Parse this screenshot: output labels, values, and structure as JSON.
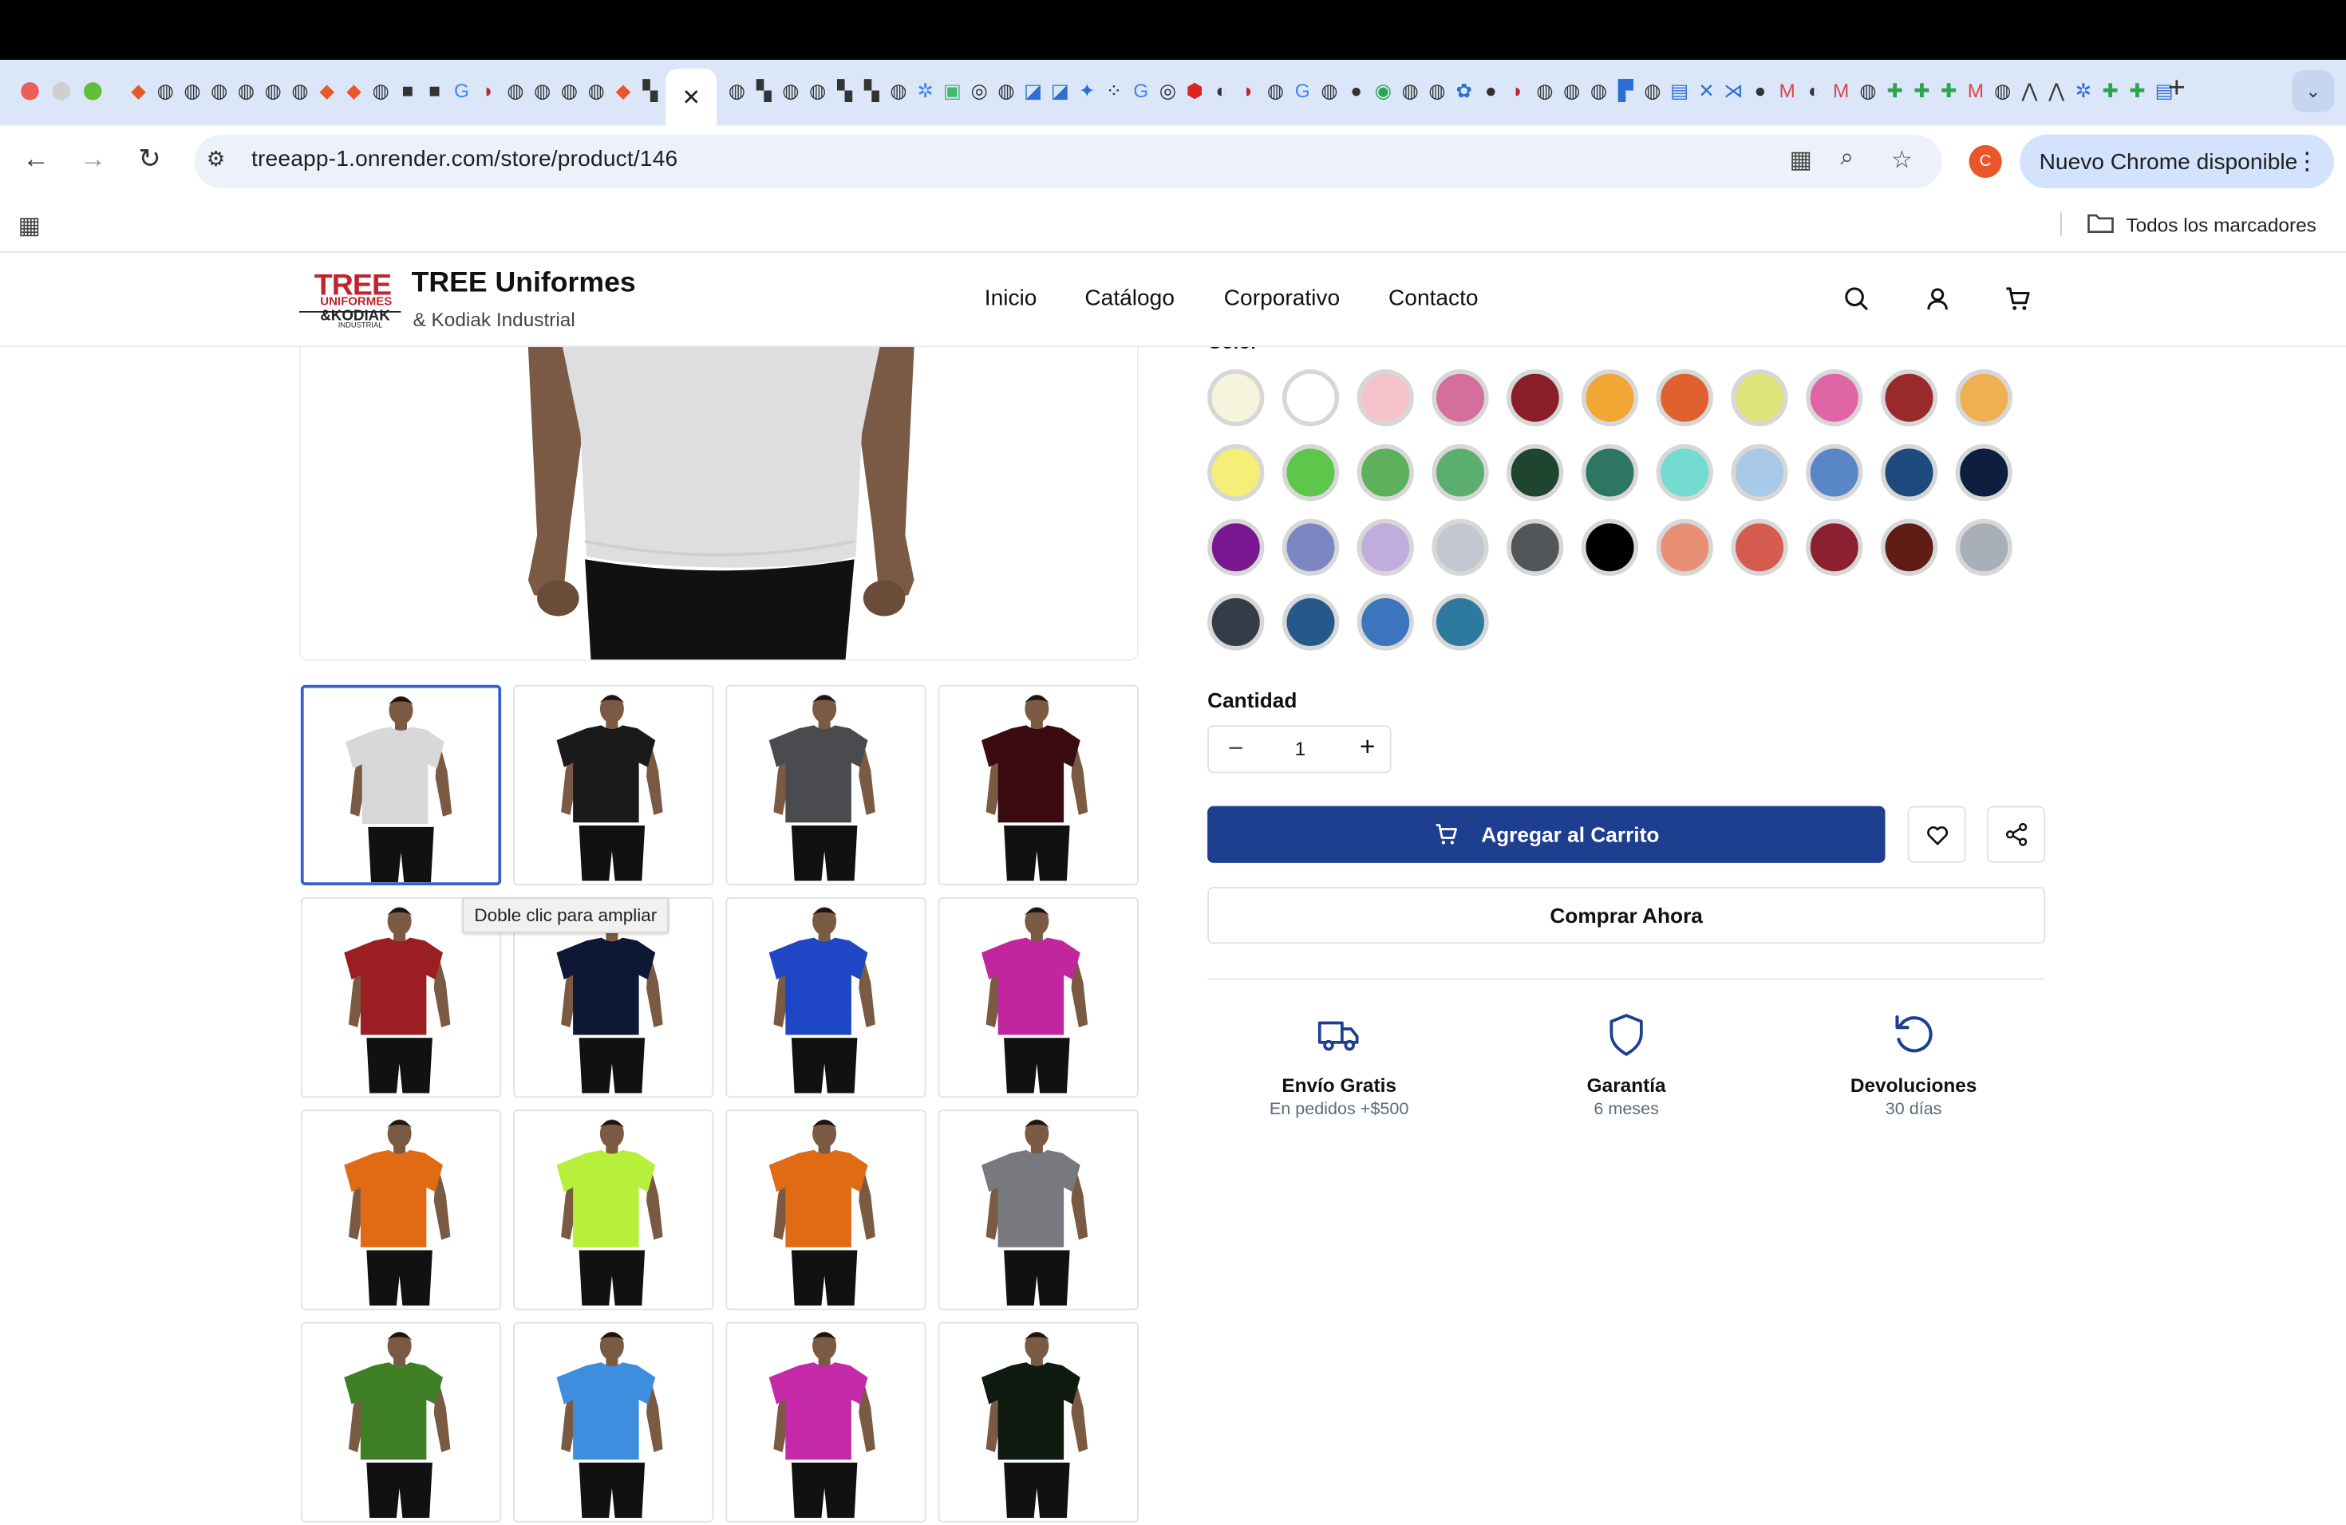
{
  "browser": {
    "url": "treeapp-1.onrender.com/store/product/146",
    "update_button": "Nuevo Chrome disponible",
    "profile_initial": "C",
    "bookmarks_label": "Todos los marcadores",
    "active_tab_close": "✕",
    "new_tab": "+"
  },
  "site": {
    "brand_name": "TREE Uniformes",
    "brand_sub": "& Kodiak Industrial",
    "logo_text": [
      "TREE",
      "UNIFORMES",
      "&KODIAK",
      "INDUSTRIAL"
    ],
    "nav": [
      "Inicio",
      "Catálogo",
      "Corporativo",
      "Contacto"
    ]
  },
  "product": {
    "color_label": "Color",
    "swatches": [
      "#f6f4dc",
      "#ffffff",
      "#f4c3cb",
      "#d66e9d",
      "#8a1f2b",
      "#f2a735",
      "#e0602e",
      "#dde47a",
      "#e065a4",
      "#992a2c",
      "#efb052",
      "#f6ee76",
      "#5cc74a",
      "#5db15a",
      "#5cae6e",
      "#1f4531",
      "#2c7662",
      "#73dbcf",
      "#a9c9e8",
      "#5886c6",
      "#1f4a7d",
      "#0d1e3f",
      "#7a168f",
      "#7b86c3",
      "#c0addc",
      "#c2c7d0",
      "#535659",
      "#000000",
      "#e98f76",
      "#d55b4f",
      "#8b2030",
      "#5f1d16",
      "#a9afb8",
      "#333d48",
      "#24598a",
      "#3d74be",
      "#2e7a9e"
    ],
    "thumbnail_shirt_colors": [
      "#d8d8da",
      "#1a1a1a",
      "#4a4b4e",
      "#3a0c12",
      "#9b1f22",
      "#0e1733",
      "#1f46c4",
      "#c2269f",
      "#e16a14",
      "#b6f03a",
      "#e16a14",
      "#77797e",
      "#3f7f25",
      "#3e8ee0",
      "#c42aa8",
      "#0f1a10"
    ],
    "selected_thumbnail": 1,
    "tooltip": "Doble clic para ampliar",
    "quantity_label": "Cantidad",
    "quantity": "1",
    "minus": "−",
    "plus": "+",
    "add_to_cart": "Agregar al Carrito",
    "buy_now": "Comprar Ahora",
    "features": [
      {
        "title": "Envío Gratis",
        "subtitle": "En pedidos +$500",
        "icon": "truck-icon"
      },
      {
        "title": "Garantía",
        "subtitle": "6 meses",
        "icon": "shield-icon"
      },
      {
        "title": "Devoluciones",
        "subtitle": "30 días",
        "icon": "rotate-ccw-icon"
      }
    ]
  },
  "colors": {
    "primary": "#1e3e8f",
    "logo_red": "#c0242d",
    "selected_border": "#3361c9",
    "tabstrip": "#dbe6f8"
  }
}
